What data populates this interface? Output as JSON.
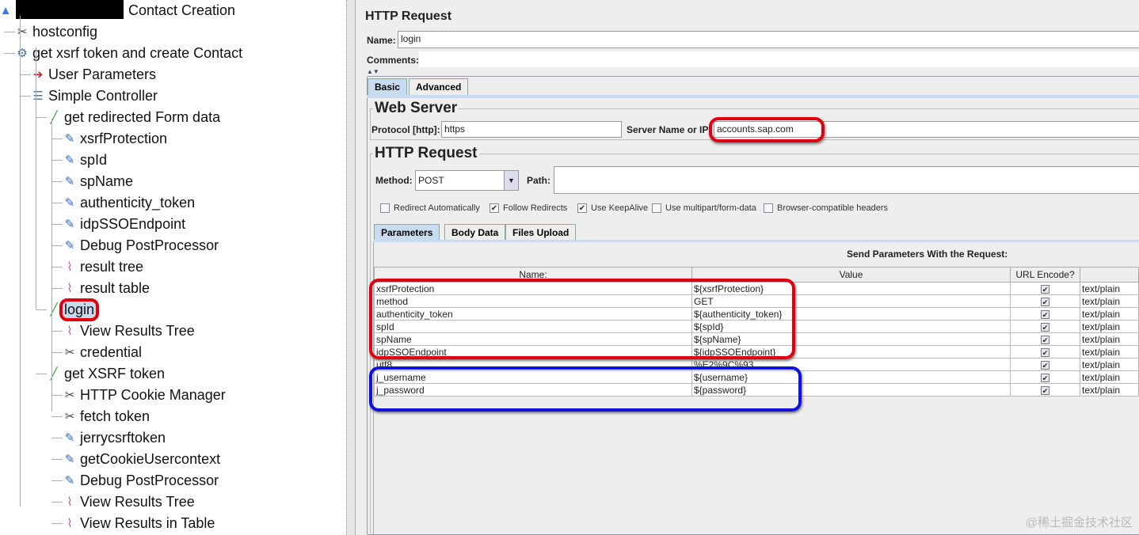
{
  "tree": [
    {
      "label": "Contact Creation",
      "level": 0,
      "icon": "flask-icon"
    },
    {
      "label": "hostconfig",
      "level": 1,
      "icon": "wrench-icon"
    },
    {
      "label": "get xsrf token and create Contact",
      "level": 1,
      "icon": "gear-icon"
    },
    {
      "label": "User Parameters",
      "level": 2,
      "icon": "preprocessor-icon"
    },
    {
      "label": "Simple Controller",
      "level": 2,
      "icon": "controller-icon"
    },
    {
      "label": "get redirected Form data",
      "level": 3,
      "icon": "sampler-pipette-icon"
    },
    {
      "label": "xsrfProtection",
      "level": 4,
      "icon": "extractor-icon"
    },
    {
      "label": "spId",
      "level": 4,
      "icon": "extractor-icon"
    },
    {
      "label": "spName",
      "level": 4,
      "icon": "extractor-icon"
    },
    {
      "label": "authenticity_token",
      "level": 4,
      "icon": "extractor-icon"
    },
    {
      "label": "idpSSOEndpoint",
      "level": 4,
      "icon": "extractor-icon"
    },
    {
      "label": "Debug PostProcessor",
      "level": 4,
      "icon": "extractor-icon"
    },
    {
      "label": "result tree",
      "level": 4,
      "icon": "listener-graph-icon"
    },
    {
      "label": "result table",
      "level": 4,
      "icon": "listener-graph-icon"
    },
    {
      "label": "login",
      "level": 3,
      "icon": "sampler-pipette-icon",
      "selected": true
    },
    {
      "label": "View Results Tree",
      "level": 4,
      "icon": "listener-graph-icon"
    },
    {
      "label": "credential",
      "level": 4,
      "icon": "wrench-icon"
    },
    {
      "label": "get XSRF token",
      "level": 3,
      "icon": "sampler-pipette-icon"
    },
    {
      "label": "HTTP Cookie Manager",
      "level": 4,
      "icon": "wrench-icon"
    },
    {
      "label": "fetch token",
      "level": 4,
      "icon": "wrench-icon"
    },
    {
      "label": "jerrycsrftoken",
      "level": 4,
      "icon": "extractor-icon"
    },
    {
      "label": "getCookieUsercontext",
      "level": 4,
      "icon": "extractor-icon"
    },
    {
      "label": "Debug PostProcessor",
      "level": 4,
      "icon": "extractor-icon"
    },
    {
      "label": "View Results Tree",
      "level": 4,
      "icon": "listener-graph-icon"
    },
    {
      "label": "View Results in Table",
      "level": 4,
      "icon": "listener-graph-icon"
    }
  ],
  "panel": {
    "title": "HTTP Request",
    "name_label": "Name:",
    "name_value": "login",
    "comments_label": "Comments:",
    "comments_value": "",
    "tabs": [
      "Basic",
      "Advanced"
    ],
    "web_server": "Web Server",
    "protocol_label": "Protocol [http]:",
    "protocol_value": "https",
    "server_label": "Server Name or IP:",
    "server_value": "accounts.sap.com",
    "http_request": "HTTP Request",
    "method_label": "Method:",
    "method_value": "POST",
    "path_label": "Path:",
    "path_value": "",
    "checkboxes": [
      {
        "label": "Redirect Automatically",
        "checked": false
      },
      {
        "label": "Follow Redirects",
        "checked": true
      },
      {
        "label": "Use KeepAlive",
        "checked": true
      },
      {
        "label": "Use multipart/form-data",
        "checked": false
      },
      {
        "label": "Browser-compatible headers",
        "checked": false
      }
    ],
    "sub_tabs": [
      "Parameters",
      "Body Data",
      "Files Upload"
    ],
    "params_title": "Send Parameters With the Request:",
    "columns": [
      "Name:",
      "Value",
      "URL Encode?",
      ""
    ],
    "params": [
      {
        "name": "xsrfProtection",
        "value": "${xsrfProtection}",
        "encode": true,
        "type": "text/plain"
      },
      {
        "name": "method",
        "value": "GET",
        "encode": true,
        "type": "text/plain"
      },
      {
        "name": "authenticity_token",
        "value": "${authenticity_token}",
        "encode": true,
        "type": "text/plain"
      },
      {
        "name": "spId",
        "value": "${spId}",
        "encode": true,
        "type": "text/plain"
      },
      {
        "name": "spName",
        "value": "${spName}",
        "encode": true,
        "type": "text/plain"
      },
      {
        "name": "idpSSOEndpoint",
        "value": "${idpSSOEndpoint}",
        "encode": true,
        "type": "text/plain"
      },
      {
        "name": "utf8",
        "value": "%E2%9C%93",
        "encode": true,
        "type": "text/plain"
      },
      {
        "name": "j_username",
        "value": "${username}",
        "encode": true,
        "type": "text/plain"
      },
      {
        "name": "j_password",
        "value": "${password}",
        "encode": true,
        "type": "text/plain"
      }
    ]
  },
  "colors": {
    "highlight_red": "#e00010",
    "highlight_blue": "#1010e0",
    "tab_selected": "#c9dcef"
  },
  "watermark": "@稀土掘金技术社区"
}
